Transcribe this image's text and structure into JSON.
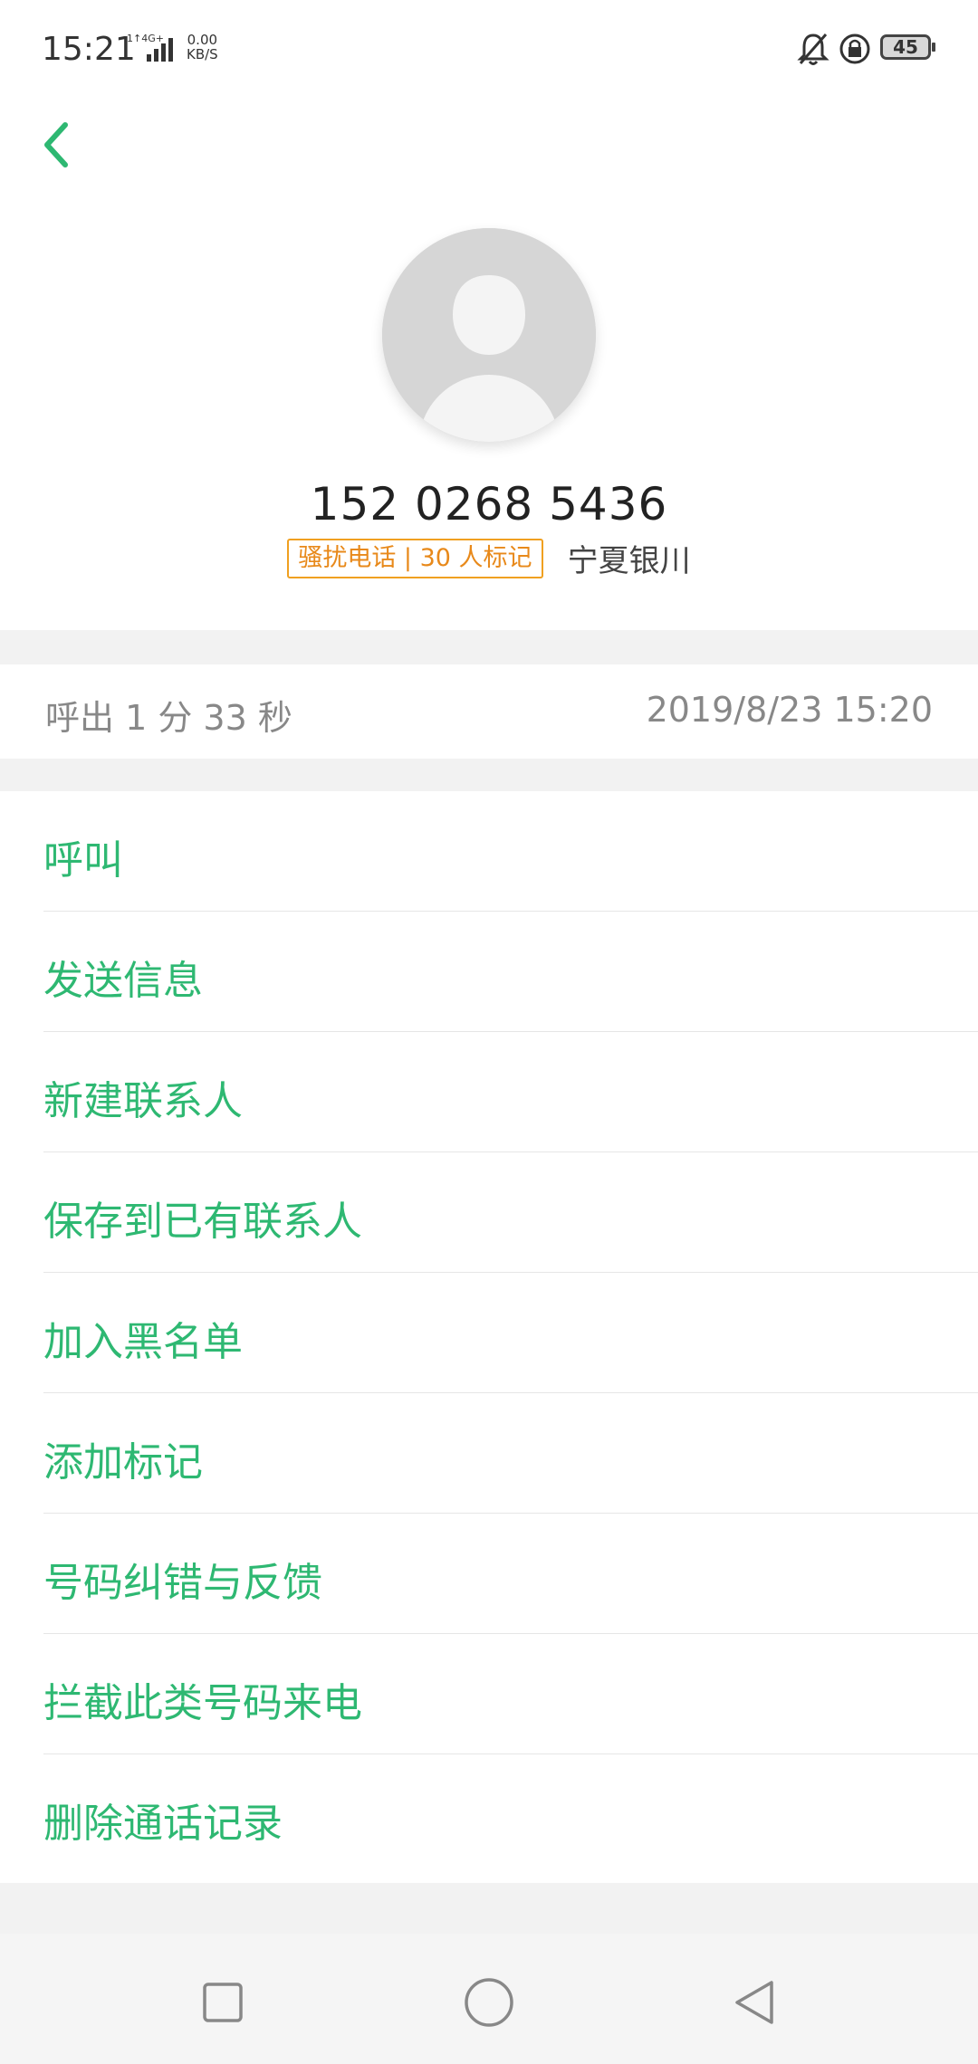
{
  "status_bar": {
    "time": "15:21",
    "network": "4G",
    "speed_value": "0.00",
    "speed_unit": "KB/S",
    "battery": "45"
  },
  "contact": {
    "phone": "152 0268 5436",
    "spam_tag": "骚扰电话 | 30 人标记",
    "location": "宁夏银川"
  },
  "call_log": {
    "type_duration": "呼出  1 分 33 秒",
    "datetime": "2019/8/23 15:20"
  },
  "actions": [
    {
      "label": "呼叫"
    },
    {
      "label": "发送信息"
    },
    {
      "label": "新建联系人"
    },
    {
      "label": "保存到已有联系人"
    },
    {
      "label": "加入黑名单"
    },
    {
      "label": "添加标记"
    },
    {
      "label": "号码纠错与反馈"
    },
    {
      "label": "拦截此类号码来电"
    },
    {
      "label": "删除通话记录"
    }
  ],
  "colors": {
    "accent": "#2eb872",
    "spam_tag": "#e8891a",
    "secondary_text": "#888888"
  },
  "icons": {
    "back": "chevron-left-icon",
    "avatar": "person-placeholder-icon",
    "recent": "square-icon",
    "home": "circle-icon",
    "nav_back": "triangle-back-icon"
  }
}
